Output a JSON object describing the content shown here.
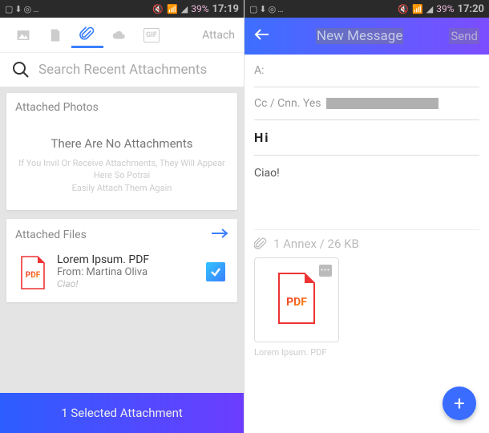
{
  "status": {
    "left": {
      "battery": "39%",
      "time": "17:19"
    },
    "right": {
      "battery": "39%",
      "time": "17:20"
    }
  },
  "left": {
    "tabs": {
      "attach_label": "Attach"
    },
    "search": {
      "placeholder": "Search Recent Attachments"
    },
    "cards": {
      "photos": {
        "title": "Attached Photos",
        "empty_title": "There Are No Attachments",
        "empty_sub1": "If You Invil Or Receive Attachments, They Will Appear Here So Potrai",
        "empty_sub2": "Easily Attach Them Again"
      },
      "files": {
        "title": "Attached Files",
        "item": {
          "name": "Lorem Ipsum. PDF",
          "from": "From: Martina Oliva",
          "subject": "Ciao!"
        }
      }
    },
    "bottom": "1 Selected Attachment"
  },
  "right": {
    "header": {
      "title": "New Message",
      "send": "Send"
    },
    "compose": {
      "to_label": "A:",
      "cc_label": "Cc / Cnn. Yes",
      "subject": "Hi",
      "body": "Ciao!"
    },
    "attach": {
      "summary": "1 Annex / 26 KB",
      "thumb_label": "PDF",
      "caption": "Lorem Ipsum. PDF",
      "sub": ""
    }
  }
}
